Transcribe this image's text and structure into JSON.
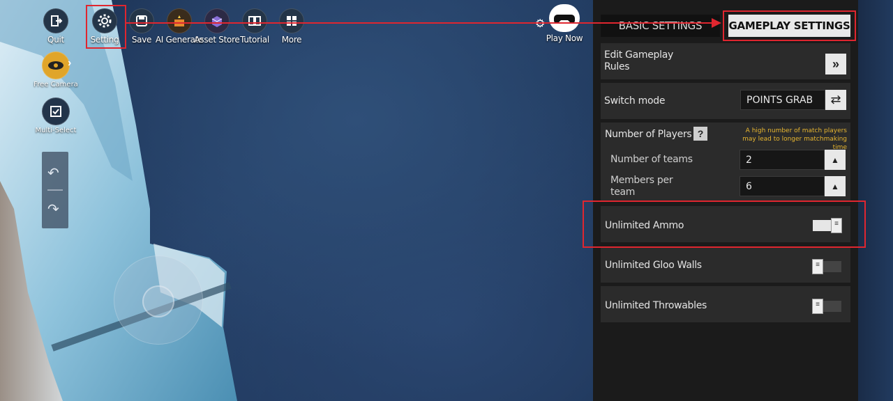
{
  "toolbar": {
    "quit": "Quit",
    "setting": "Setting",
    "save": "Save",
    "ai_generate": "AI Generate",
    "asset_store": "Asset Store",
    "tutorial": "Tutorial",
    "more": "More",
    "play_now": "Play Now"
  },
  "left_tools": {
    "free_camera": "Free Camera",
    "multi_select": "Multi-Select"
  },
  "tabs": {
    "basic": "BASIC SETTINGS",
    "gameplay": "GAMEPLAY SETTINGS"
  },
  "settings": {
    "edit_rules": "Edit Gameplay Rules",
    "switch_mode_label": "Switch mode",
    "switch_mode_value": "POINTS GRAB",
    "players_label": "Number of Players",
    "players_note": "A high number of match players may lead to longer matchmaking time",
    "teams_label": "Number of teams",
    "teams_value": "2",
    "members_label": "Members per team",
    "members_value": "6",
    "unlimited_ammo": "Unlimited Ammo",
    "unlimited_ammo_on": true,
    "unlimited_gloo": "Unlimited Gloo Walls",
    "unlimited_gloo_on": false,
    "unlimited_throwables": "Unlimited Throwables",
    "unlimited_throwables_on": false
  },
  "colors": {
    "annotation": "#e0262f",
    "note": "#e8b630",
    "panel": "#1b1b1b"
  }
}
